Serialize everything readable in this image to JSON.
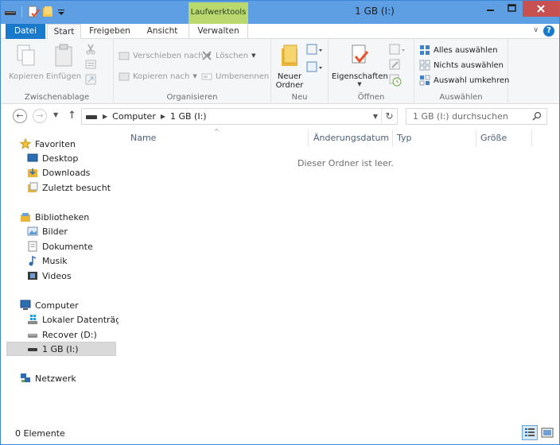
{
  "window": {
    "title": "1 GB (I:)",
    "context_tab_group": "Laufwerktools",
    "accent": "#1979ca",
    "titlebar_color": "#5d9fe2",
    "context_color": "#b9d96f"
  },
  "tabs": [
    {
      "label": "Datei"
    },
    {
      "label": "Start"
    },
    {
      "label": "Freigeben"
    },
    {
      "label": "Ansicht"
    },
    {
      "label": "Verwalten"
    }
  ],
  "help_label": "?",
  "ribbon": {
    "clipboard": {
      "label": "Zwischenablage",
      "copy": "Kopieren",
      "paste": "Einfügen"
    },
    "organize": {
      "label": "Organisieren",
      "move_to": "Verschieben nach",
      "copy_to": "Kopieren nach",
      "delete": "Löschen",
      "rename": "Umbenennen"
    },
    "new": {
      "label": "Neu",
      "new_folder_line1": "Neuer",
      "new_folder_line2": "Ordner"
    },
    "open": {
      "label": "Öffnen",
      "properties": "Eigenschaften"
    },
    "select": {
      "label": "Auswählen",
      "select_all": "Alles auswählen",
      "select_none": "Nichts auswählen",
      "invert": "Auswahl umkehren"
    }
  },
  "address": {
    "crumbs": [
      "Computer",
      "1 GB (I:)"
    ],
    "search_placeholder": "1 GB (I:) durchsuchen"
  },
  "nav": {
    "favorites": "Favoriten",
    "desktop": "Desktop",
    "downloads": "Downloads",
    "recent": "Zuletzt besucht",
    "libraries": "Bibliotheken",
    "pictures": "Bilder",
    "documents": "Dokumente",
    "music": "Musik",
    "videos": "Videos",
    "computer": "Computer",
    "local_disk": "Lokaler Datenträger",
    "recover": "Recover (D:)",
    "usb": "1 GB (I:)",
    "network": "Netzwerk"
  },
  "columns": [
    "Name",
    "Änderungsdatum",
    "Typ",
    "Größe"
  ],
  "empty_message": "Dieser Ordner ist leer.",
  "status": {
    "count": "0 Elemente"
  }
}
